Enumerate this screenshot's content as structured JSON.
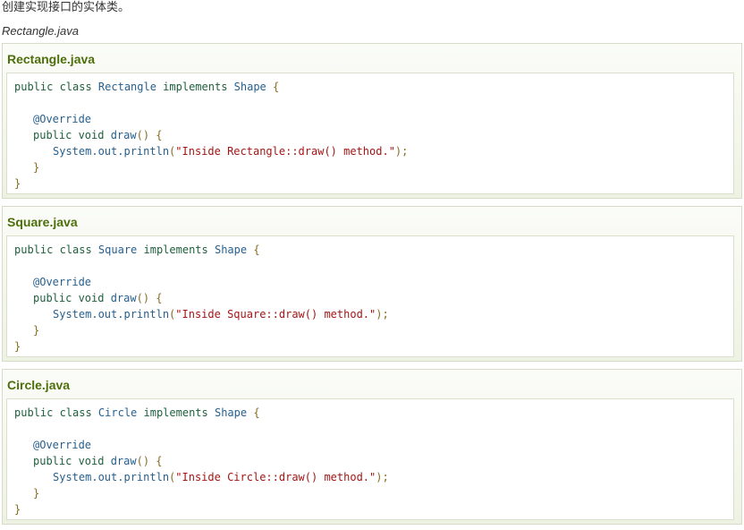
{
  "intro_text": "创建实现接口的实体类。",
  "file_label": "Rectangle.java",
  "examples": [
    {
      "title": "Rectangle.java",
      "code": {
        "line1": {
          "kw1": "public class ",
          "cls": "Rectangle",
          "kw2": " implements ",
          "iface": "Shape",
          "brace": " {"
        },
        "annotation": "@Override",
        "line3": {
          "kw": "public void ",
          "fn": "draw",
          "paren": "() {"
        },
        "line4": {
          "call": "System.out.println",
          "open": "(",
          "str": "\"Inside Rectangle::draw() method.\"",
          "close": ");"
        },
        "inner_close": "}",
        "outer_close": "}"
      }
    },
    {
      "title": "Square.java",
      "code": {
        "line1": {
          "kw1": "public class ",
          "cls": "Square",
          "kw2": " implements ",
          "iface": "Shape",
          "brace": " {"
        },
        "annotation": "@Override",
        "line3": {
          "kw": "public void ",
          "fn": "draw",
          "paren": "() {"
        },
        "line4": {
          "call": "System.out.println",
          "open": "(",
          "str": "\"Inside Square::draw() method.\"",
          "close": ");"
        },
        "inner_close": "}",
        "outer_close": "}"
      }
    },
    {
      "title": "Circle.java",
      "code": {
        "line1": {
          "kw1": "public class ",
          "cls": "Circle",
          "kw2": " implements ",
          "iface": "Shape",
          "brace": " {"
        },
        "annotation": "@Override",
        "line3": {
          "kw": "public void ",
          "fn": "draw",
          "paren": "() {"
        },
        "line4": {
          "call": "System.out.println",
          "open": "(",
          "str": "\"Inside Circle::draw() method.\"",
          "close": ");"
        },
        "inner_close": "}",
        "outer_close": "}"
      }
    }
  ],
  "colors": {
    "title_green": "#4e6f0b",
    "keyword": "#1e5f3d",
    "type": "#27608f",
    "string": "#a31515",
    "punctuation": "#866c20"
  }
}
